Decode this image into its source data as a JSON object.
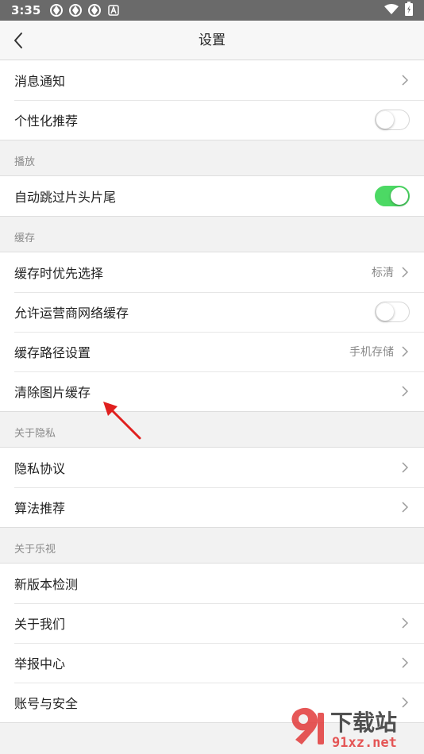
{
  "status_bar": {
    "time": "3:35",
    "icons": [
      "app-icon",
      "app-icon",
      "app-icon",
      "font-icon"
    ],
    "right_icons": [
      "wifi-icon",
      "battery-icon"
    ]
  },
  "header": {
    "title": "设置",
    "back_icon": "chevron-left-icon"
  },
  "groups": {
    "general": {
      "items": [
        {
          "label": "消息通知",
          "trailing": "chevron"
        },
        {
          "label": "个性化推荐",
          "trailing": "toggle",
          "on": false
        }
      ]
    },
    "playback": {
      "title": "播放",
      "items": [
        {
          "label": "自动跳过片头片尾",
          "trailing": "toggle",
          "on": true
        }
      ]
    },
    "cache": {
      "title": "缓存",
      "items": [
        {
          "label": "缓存时优先选择",
          "value": "标清",
          "trailing": "chevron"
        },
        {
          "label": "允许运营商网络缓存",
          "trailing": "toggle",
          "on": false
        },
        {
          "label": "缓存路径设置",
          "value": "手机存储",
          "trailing": "chevron"
        },
        {
          "label": "清除图片缓存",
          "trailing": "chevron"
        }
      ]
    },
    "privacy": {
      "title": "关于隐私",
      "items": [
        {
          "label": "隐私协议",
          "trailing": "chevron"
        },
        {
          "label": "算法推荐",
          "trailing": "chevron"
        }
      ]
    },
    "about": {
      "title": "关于乐视",
      "items": [
        {
          "label": "新版本检测",
          "trailing": "none"
        },
        {
          "label": "关于我们",
          "trailing": "chevron"
        },
        {
          "label": "举报中心",
          "trailing": "chevron"
        },
        {
          "label": "账号与安全",
          "trailing": "chevron"
        }
      ]
    }
  },
  "watermark": {
    "text_cn": "下载站",
    "text_url": "91xz.net"
  },
  "colors": {
    "toggle_on": "#4cd964",
    "annotation_arrow": "#e0201f",
    "watermark": "#e23a3a"
  }
}
